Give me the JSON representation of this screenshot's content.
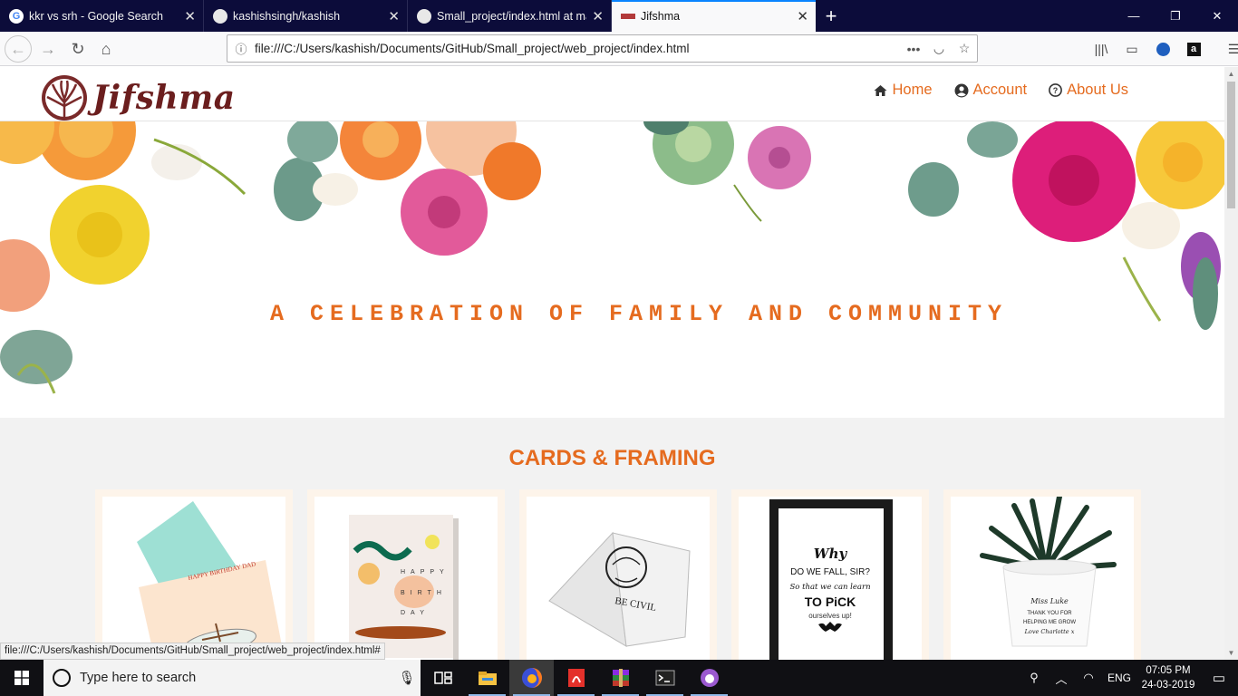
{
  "browser": {
    "tabs": [
      {
        "title": "kkr vs srh - Google Search",
        "icon": "google-icon"
      },
      {
        "title": "kashishsingh/kashish",
        "icon": "github-icon"
      },
      {
        "title": "Small_project/index.html at ma",
        "icon": "github-icon"
      },
      {
        "title": "Jifshma",
        "icon": "jifshma-favicon",
        "active": true
      }
    ],
    "new_tab_symbol": "+",
    "url": "file:///C:/Users/kashish/Documents/GitHub/Small_project/web_project/index.html",
    "status_url": "file:///C:/Users/kashish/Documents/GitHub/Small_project/web_project/index.html#"
  },
  "site": {
    "brand": "Jifshma",
    "nav": [
      {
        "label": "Home",
        "icon": "home-icon"
      },
      {
        "label": "Account",
        "icon": "user-circle-icon"
      },
      {
        "label": "About Us",
        "icon": "question-circle-icon"
      }
    ],
    "hero_text": "A CELEBRATION OF FAMILY AND COMMUNITY",
    "section_title": "CARDS & FRAMING",
    "frame_text": {
      "line1": "Why",
      "line2": "DO WE FALL, SIR?",
      "line3": "So that we can learn",
      "line4": "TO PiCK",
      "line5": "ourselves up!"
    },
    "pot_text": {
      "line1": "Miss Luke",
      "line2": "THANK YOU FOR",
      "line3": "HELPING ME GROW",
      "line4": "Love Charlotte x"
    },
    "card1_text": "HAPPY BIRTHDAY DAD",
    "card2_text": {
      "line1": "HAPPY",
      "line2": "BIRTH",
      "line3": "DAY"
    },
    "card3_text": "BE CIVIL"
  },
  "taskbar": {
    "search_placeholder": "Type here to search",
    "language": "ENG",
    "time": "07:05 PM",
    "date": "24-03-2019"
  },
  "colors": {
    "accent": "#e56b1f",
    "brand": "#6b1e1e",
    "tabbar": "#0c0c3a"
  }
}
